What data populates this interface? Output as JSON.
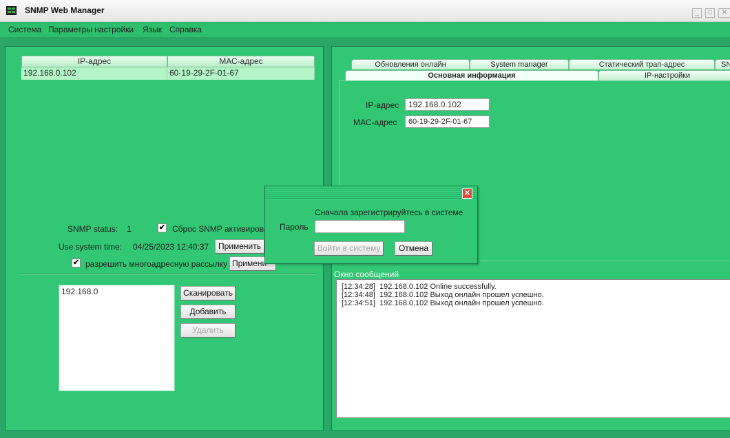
{
  "window": {
    "title": "SNMP Web Manager",
    "minimize": "_",
    "maximize": "□",
    "close": "✕"
  },
  "menu": [
    "Система",
    "Параметры настройки",
    "Язык",
    "Справка"
  ],
  "devices": {
    "headers": [
      "IP-адрес",
      "МАС-адрес"
    ],
    "rows": [
      [
        "192.168.0.102",
        "60-19-29-2F-01-67"
      ]
    ]
  },
  "snmp": {
    "status_label": "SNMP status:",
    "status_value": "1",
    "reset_label": "Сброс SNMP активирова",
    "reset_checked": true,
    "system_time_label": "Use system time:",
    "system_time_value": "04/25/2023 12:40:37",
    "apply1": "Применить",
    "multicast_label": "разрешить многоадресную рассылку",
    "multicast_checked": true,
    "apply2": "Примени"
  },
  "scan": {
    "items": [
      "192.168.0"
    ],
    "scan_btn": "Сканировать",
    "add_btn": "Добавить",
    "delete_btn": "Удалить"
  },
  "tabs": {
    "row1": [
      "Обновления онлайн",
      "System manager",
      "Статический трап-адрес",
      "SN"
    ],
    "row2": [
      "Основная информация",
      "IP-настройки"
    ]
  },
  "info": {
    "ip_label": "IP-адрес",
    "ip_value": "192.168.0.102",
    "mac_label": "МАС-адрес",
    "mac_value": "60-19-29-2F-01-67"
  },
  "messages": {
    "header": "Окно сообщений",
    "lines": [
      "[12:34:28]  192.168.0.102 Online successfully.",
      "[12:34:48]  192.168.0.102 Выход онлайн прошел успешно.",
      "[12:34:51]  192.168.0.102 Выход онлайн прошел успешно."
    ]
  },
  "dialog": {
    "message": "Сначала зарегистрируйтесь в системе",
    "password_label": "Пароль",
    "password_value": "",
    "login_btn": "Войти в систему",
    "cancel_btn": "Отмена",
    "close": "✕"
  },
  "colors": {
    "frame": "#2aa766",
    "panel": "#32c774",
    "menubar": "#2ebf6e",
    "row_selected": "#b3f5c6"
  },
  "icons": {
    "app": "app-icon",
    "check": "checkmark-icon",
    "close": "close-icon"
  }
}
